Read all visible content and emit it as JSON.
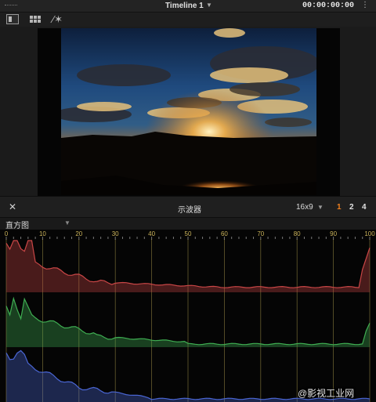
{
  "header": {
    "timeline_title": "Timeline 1",
    "timecode": "00:00:00:00"
  },
  "toolbar": {
    "icons": [
      "single-viewer-icon",
      "grid-viewer-icon",
      "magic-wand-icon"
    ]
  },
  "scope": {
    "title": "示波器",
    "aspect": "16x9",
    "pages": [
      "1",
      "2",
      "4"
    ],
    "active_page": "1",
    "type": "直方图",
    "ticks": [
      "0",
      "10",
      "20",
      "30",
      "40",
      "50",
      "60",
      "70",
      "80",
      "90",
      "100"
    ],
    "channels": [
      {
        "name": "red",
        "color": "#c94646"
      },
      {
        "name": "green",
        "color": "#3fae52"
      },
      {
        "name": "blue",
        "color": "#4a66d4"
      }
    ]
  },
  "watermark": "@影视工业网",
  "colors": {
    "accent": "#f07f1e",
    "panel": "#1f1f1f",
    "grid": "#b8a650"
  }
}
